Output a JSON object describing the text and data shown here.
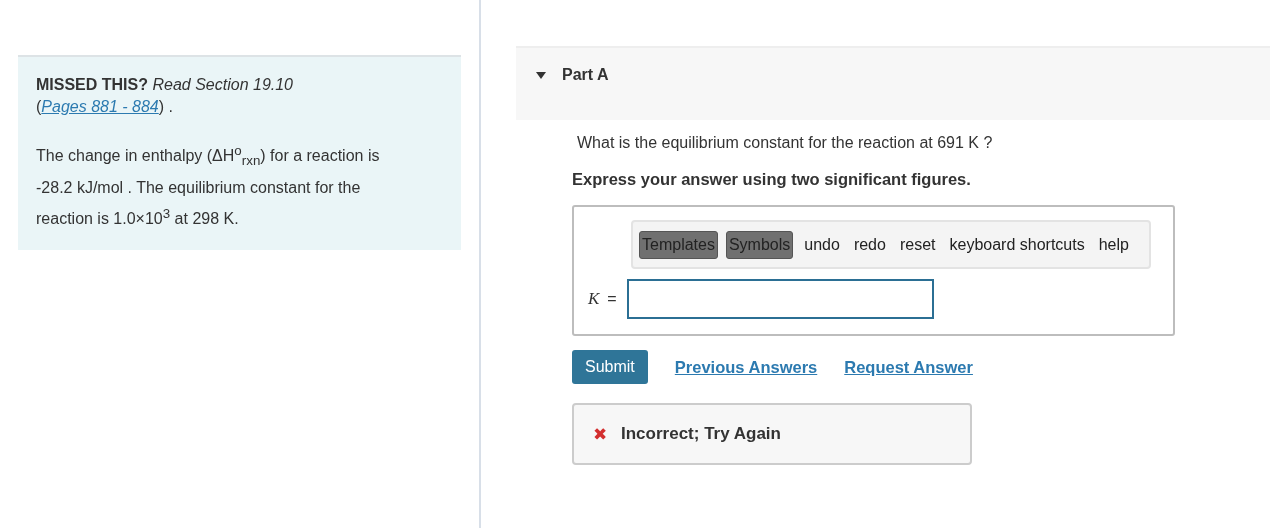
{
  "hint": {
    "lead": "**MISSED THIS?** *Read Section 19.10*",
    "open": "(",
    "link": "Pages 881 - 884",
    "close": ") ."
  },
  "problem": "The change in enthalpy (ΔH$^{o}$$_{rxn}$) for a reaction is -28.2 kJ/mol . The equilibrium constant for the reaction is 1.0×10$^{3}$ at 298 K.",
  "part": {
    "title": "Part A",
    "expanded": true
  },
  "question": "What is the equilibrium constant for the reaction at 691 K ?",
  "instruction": "Express your answer using two significant figures.",
  "toolbar": [
    {
      "label": "Templates",
      "kind": "button"
    },
    {
      "label": "Symbols",
      "kind": "button"
    },
    {
      "label": "undo",
      "kind": "link"
    },
    {
      "label": "redo",
      "kind": "link"
    },
    {
      "label": "reset",
      "kind": "link"
    },
    {
      "label": "keyboard shortcuts",
      "kind": "link"
    },
    {
      "label": "help",
      "kind": "link"
    }
  ],
  "answer": {
    "label": "K",
    "equals": "="
  },
  "actions": {
    "submit": "Submit",
    "links": [
      "Previous Answers",
      "Request Answer"
    ]
  },
  "feedback": {
    "correct": false,
    "icon": "✖",
    "message": "Incorrect; Try Again"
  }
}
